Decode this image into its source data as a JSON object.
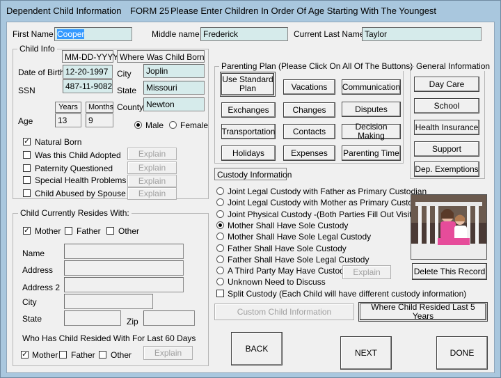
{
  "window": {
    "title": "Dependent Child Information",
    "form_label": "FORM 25",
    "instruction": "Please Enter Children In Order Of Age Starting With The Youngest"
  },
  "name": {
    "first_label": "First Name",
    "first_value": "Cooper",
    "middle_label": "Middle name",
    "middle_value": "Frederick",
    "last_label": "Current Last Name",
    "last_value": "Taylor"
  },
  "child_info": {
    "title": "Child Info",
    "date_header": "MM-DD-YYYY",
    "born_header": "Where Was Child Born",
    "dob_label": "Date of Birth",
    "dob_value": "12-20-1997",
    "ssn_label": "SSN",
    "ssn_value": "487-11-9082",
    "city_label": "City",
    "city_value": "Joplin",
    "state_label": "State",
    "state_value": "Missouri",
    "county_label": "County",
    "county_value": "Newton",
    "years_label": "Years",
    "months_label": "Months",
    "age_label": "Age",
    "age_years": "13",
    "age_months": "9",
    "male_label": "Male",
    "female_label": "Female",
    "gender": "Male",
    "natural_born_label": "Natural Born",
    "adopted_label": "Was this Child Adopted",
    "paternity_label": "Paternity Questioned",
    "health_label": "Special Health Problems",
    "abused_label": "Child Abused by Spouse",
    "explain_label": "Explain"
  },
  "parenting_plan": {
    "title": "Parenting Plan (Please Click On All Of The Buttons)",
    "buttons": [
      "Use Standard Plan",
      "Vacations",
      "Communication",
      "Exchanges",
      "Changes",
      "Disputes",
      "Transportation",
      "Contacts",
      "Decision Making",
      "Holidays",
      "Expenses",
      "Parenting Time"
    ]
  },
  "general_info": {
    "title": "General Information",
    "buttons": [
      "Day Care",
      "School",
      "Health Insurance",
      "Support",
      "Dep. Exemptions"
    ]
  },
  "custody": {
    "title": "Custody Information",
    "options": [
      "Joint Legal Custody with Father as Primary Custodian",
      "Joint Legal Custody with Mother as Primary Custodian",
      "Joint Physical Custody -(Both Parties Fill Out Visitation)",
      "Mother Shall Have Sole Custody",
      "Mother Shall Have Sole Legal Custody",
      "Father Shall Have Sole Custody",
      "Father Shall Have Sole Legal Custody",
      "A Third Party May Have Custody",
      "Unknown Need to Discuss"
    ],
    "selected": "Mother Shall Have Sole Custody",
    "explain_label": "Explain",
    "split_label": "Split Custody (Each Child will have different custody information)",
    "custom_label": "Custom Child Information",
    "where_resided_label": "Where Child Resided Last 5 Years"
  },
  "resides": {
    "title": "Child  Currently Resides With:",
    "mother_label": "Mother",
    "father_label": "Father",
    "other_label": "Other",
    "name_label": "Name",
    "address_label": "Address",
    "address2_label": "Address 2",
    "city_label": "City",
    "state_label": "State",
    "zip_label": "Zip",
    "last60_label": "Who Has Child Resided With For Last 60 Days",
    "explain_label": "Explain"
  },
  "photo": {
    "delete_label": "Delete This Record"
  },
  "nav": {
    "back_label": "BACK",
    "next_label": "NEXT",
    "done_label": "DONE"
  },
  "colors": {
    "field_bg": "#d6ebeb",
    "window_frame": "#a9c7de",
    "selection": "#3399ff"
  }
}
